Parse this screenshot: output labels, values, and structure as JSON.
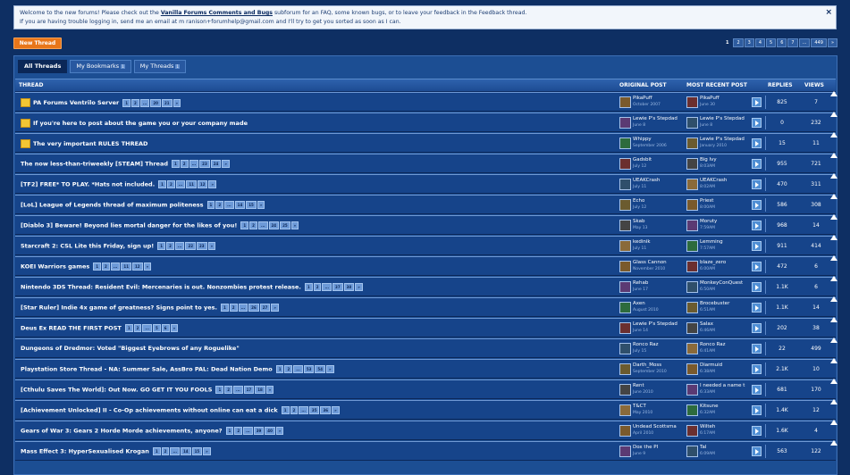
{
  "notice": {
    "line1_pre": "Welcome to the new forums! Please check out the ",
    "line1_link": "Vanilla Forums Comments and Bugs",
    "line1_post": " subforum for an FAQ, some known bugs, or to leave your feedback in the Feedback thread.",
    "line2": "If you are having trouble logging in, send me an email at m ranison+forumhelp@gmail.com and I'll try to get you sorted as soon as I can.",
    "close": "×"
  },
  "new_thread": "New Thread",
  "top_pager": [
    "1",
    "2",
    "3",
    "4",
    "5",
    "6",
    "7",
    "...",
    "449",
    "»"
  ],
  "tabs": [
    {
      "label": "All Threads",
      "count": ""
    },
    {
      "label": "My Bookmarks",
      "count": "1"
    },
    {
      "label": "My Threads",
      "count": "1"
    }
  ],
  "columns": {
    "thread": "THREAD",
    "original": "ORIGINAL POST",
    "recent": "MOST RECENT POST",
    "replies": "REPLIES",
    "views": "VIEWS"
  },
  "threads": [
    {
      "title": "PA Forums Ventrilo Server",
      "sticky": true,
      "pager": [
        "1",
        "2",
        "...",
        "20",
        "21",
        "»"
      ],
      "op": "PikaPuff",
      "op_date": "October 2007",
      "rp": "PikaPuff",
      "rp_date": "June 30",
      "replies": "825",
      "views": "7"
    },
    {
      "title": "If you're here to post about the game you or your company made",
      "sticky": true,
      "pager": [],
      "op": "Lewie P's Stepdad",
      "op_date": "June 8",
      "rp": "Lewie P's Stepdad",
      "rp_date": "June 8",
      "replies": "0",
      "views": "232"
    },
    {
      "title": "The very important RULES THREAD",
      "sticky": true,
      "pager": [],
      "op": "Whippy",
      "op_date": "September 2006",
      "rp": "Lewie P's Stepdad",
      "rp_date": "January 2010",
      "replies": "15",
      "views": "11"
    },
    {
      "title": "The now less-than-triweekly [STEAM] Thread",
      "sticky": false,
      "pager": [
        "1",
        "2",
        "...",
        "23",
        "24",
        "»"
      ],
      "op": "Gadsbit",
      "op_date": "July 12",
      "rp": "Big Ivy",
      "rp_date": "8:03AM",
      "replies": "955",
      "views": "721"
    },
    {
      "title": "[TF2] FREE* TO PLAY. *Hats not included.",
      "sticky": false,
      "pager": [
        "1",
        "2",
        "...",
        "11",
        "12",
        "»"
      ],
      "op": "UEAKCrash",
      "op_date": "July 11",
      "rp": "UEAKCrash",
      "rp_date": "8:02AM",
      "replies": "470",
      "views": "311"
    },
    {
      "title": "[LoL] League of Legends thread of maximum politeness",
      "sticky": false,
      "pager": [
        "1",
        "2",
        "...",
        "14",
        "15",
        "»"
      ],
      "op": "Echo",
      "op_date": "July 12",
      "rp": "Priest",
      "rp_date": "8:00AM",
      "replies": "586",
      "views": "308"
    },
    {
      "title": "[Diablo 3] Beware! Beyond lies mortal danger for the likes of you!",
      "sticky": false,
      "pager": [
        "1",
        "2",
        "...",
        "24",
        "25",
        "»"
      ],
      "op": "Skab",
      "op_date": "May 13",
      "rp": "Moruty",
      "rp_date": "7:59AM",
      "replies": "968",
      "views": "14"
    },
    {
      "title": "Starcraft 2: CSL Lite this Friday, sign up!",
      "sticky": false,
      "pager": [
        "1",
        "2",
        "...",
        "22",
        "23",
        "»"
      ],
      "op": "kedinik",
      "op_date": "July 11",
      "rp": "Lemming",
      "rp_date": "7:57AM",
      "replies": "911",
      "views": "414"
    },
    {
      "title": "KOEI Warriors games",
      "sticky": false,
      "pager": [
        "1",
        "2",
        "...",
        "11",
        "12",
        "»"
      ],
      "op": "Glass Cannon",
      "op_date": "November 2010",
      "rp": "blaze_zero",
      "rp_date": "6:00AM",
      "replies": "472",
      "views": "6"
    },
    {
      "title": "Nintendo 3DS Thread: Resident Evil: Mercenaries is out. Nonzombies protest release.",
      "sticky": false,
      "pager": [
        "1",
        "2",
        "...",
        "37",
        "38",
        "»"
      ],
      "op": "Rehab",
      "op_date": "June 17",
      "rp": "MonkeyConQuest",
      "rp_date": "6:50AM",
      "replies": "1.1K",
      "views": "6"
    },
    {
      "title": "[Star Ruler] Indie 4x game of greatness? Signs point to yes.",
      "sticky": false,
      "pager": [
        "1",
        "2",
        "...",
        "26",
        "27",
        "»"
      ],
      "op": "Axen",
      "op_date": "August 2010",
      "rp": "Brocebuster",
      "rp_date": "6:51AM",
      "replies": "1.1K",
      "views": "14"
    },
    {
      "title": "Deus Ex READ THE FIRST POST",
      "sticky": false,
      "pager": [
        "1",
        "2",
        "...",
        "5",
        "6",
        "»"
      ],
      "op": "Lewie P's Stepdad",
      "op_date": "June 14",
      "rp": "Salax",
      "rp_date": "6:46AM",
      "replies": "202",
      "views": "38"
    },
    {
      "title": "Dungeons of Dredmor: Voted \"Biggest Eyebrows of any Roguelike\"",
      "sticky": false,
      "pager": [],
      "op": "Ronco Raz",
      "op_date": "July 15",
      "rp": "Ronco Raz",
      "rp_date": "6:41AM",
      "replies": "22",
      "views": "499"
    },
    {
      "title": "Playstation Store Thread - NA: Summer Sale, AssBro PAL: Dead Nation Demo",
      "sticky": false,
      "pager": [
        "1",
        "2",
        "...",
        "53",
        "54",
        "»"
      ],
      "op": "Darth_Moss",
      "op_date": "September 2010",
      "rp": "Diarmuid",
      "rp_date": "6:38AM",
      "replies": "2.1K",
      "views": "10"
    },
    {
      "title": "[Cthulu Saves The World]: Out Now. GO GET IT YOU FOOLS",
      "sticky": false,
      "pager": [
        "1",
        "2",
        "...",
        "17",
        "18",
        "»"
      ],
      "op": "Rent",
      "op_date": "June 2010",
      "rp": "I needed a name t",
      "rp_date": "6:33AM",
      "replies": "681",
      "views": "170"
    },
    {
      "title": "[Achievement Unlocked] II - Co-Op achievements without online can eat a dick",
      "sticky": false,
      "pager": [
        "1",
        "2",
        "...",
        "35",
        "36",
        "»"
      ],
      "op": "T&CT",
      "op_date": "May 2010",
      "rp": "Kitsune",
      "rp_date": "6:32AM",
      "replies": "1.4K",
      "views": "12"
    },
    {
      "title": "Gears of War 3: Gears 2 Horde Morde achievements, anyone?",
      "sticky": false,
      "pager": [
        "1",
        "2",
        "...",
        "39",
        "40",
        "»"
      ],
      "op": "Undead Scottsma",
      "op_date": "April 2010",
      "rp": "Wilteh",
      "rp_date": "6:17AM",
      "replies": "1.6K",
      "views": "4"
    },
    {
      "title": "Mass Effect 3: HyperSexualised Krogan",
      "sticky": false,
      "pager": [
        "1",
        "2",
        "...",
        "14",
        "15",
        "»"
      ],
      "op": "Dox the PI",
      "op_date": "June 9",
      "rp": "Tal",
      "rp_date": "6:09AM",
      "replies": "563",
      "views": "122"
    }
  ]
}
